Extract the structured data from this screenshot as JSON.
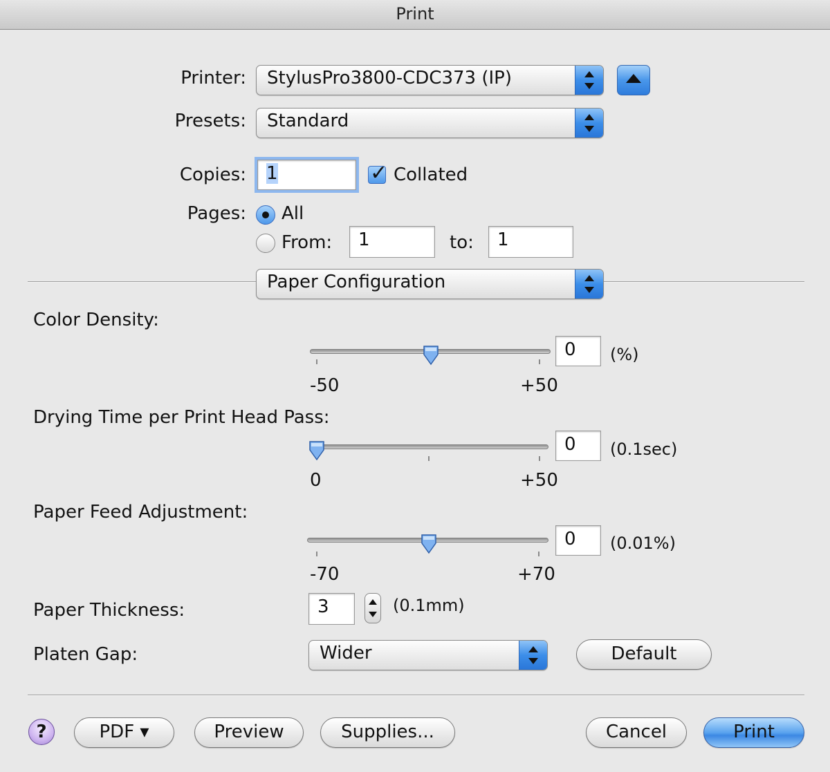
{
  "window": {
    "title": "Print"
  },
  "printer": {
    "label": "Printer:",
    "value": "StylusPro3800-CDC373 (IP)"
  },
  "presets": {
    "label": "Presets:",
    "value": "Standard"
  },
  "copies": {
    "label": "Copies:",
    "value": "1",
    "collated_label": "Collated",
    "collated": true
  },
  "pages": {
    "label": "Pages:",
    "all_label": "All",
    "from_label": "From:",
    "from_value": "1",
    "to_label": "to:",
    "to_value": "1",
    "selected": "All"
  },
  "section_popup": {
    "value": "Paper Configuration"
  },
  "color_density": {
    "label": "Color Density:",
    "value": "0",
    "unit": "(%)",
    "min_label": "-50",
    "max_label": "+50",
    "min": -50,
    "max": 50
  },
  "drying_time": {
    "label": "Drying Time per Print Head Pass:",
    "value": "0",
    "unit": "(0.1sec)",
    "min_label": "0",
    "max_label": "+50",
    "min": 0,
    "max": 50
  },
  "paper_feed": {
    "label": "Paper Feed Adjustment:",
    "value": "0",
    "unit": "(0.01%)",
    "min_label": "-70",
    "max_label": "+70",
    "min": -70,
    "max": 70
  },
  "paper_thickness": {
    "label": "Paper Thickness:",
    "value": "3",
    "unit": "(0.1mm)"
  },
  "platen_gap": {
    "label": "Platen Gap:",
    "value": "Wider",
    "default_button": "Default"
  },
  "footer": {
    "help": "?",
    "pdf": "PDF ▾",
    "preview": "Preview",
    "supplies": "Supplies...",
    "cancel": "Cancel",
    "print": "Print"
  },
  "colors": {
    "accent": "#3c8ee9",
    "window_bg": "#e8e8e8"
  }
}
